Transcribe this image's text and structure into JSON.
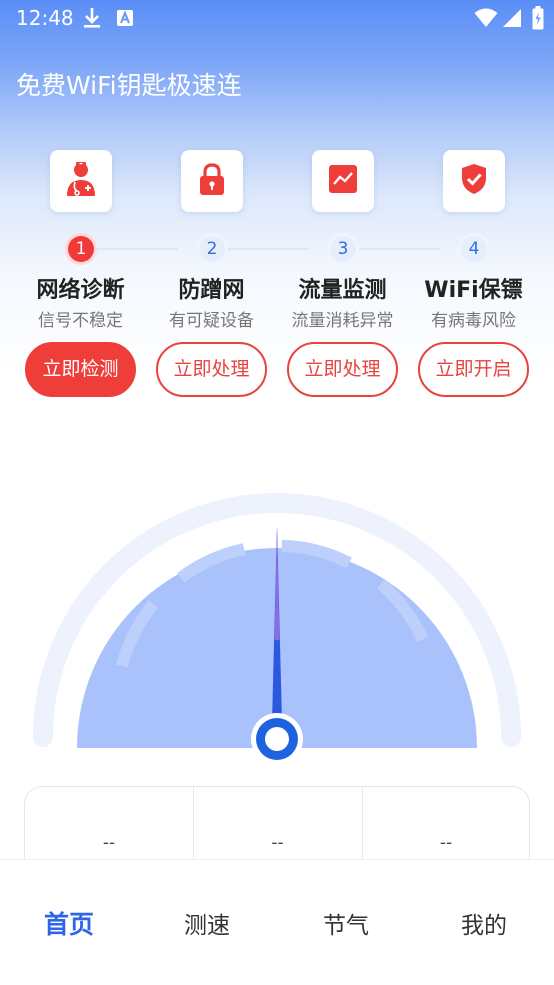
{
  "status_bar": {
    "time": "12:48",
    "left_icons": [
      "download-icon",
      "app-store-icon"
    ],
    "right_icons": [
      "wifi-icon",
      "signal-icon",
      "battery-icon"
    ]
  },
  "app_title": "免费WiFi钥匙极速连",
  "colors": {
    "primary_blue": "#2f66e8",
    "accent_red": "#ef3d3a",
    "gauge_fill": "#a9c2fb",
    "needle": "#2c58dd"
  },
  "features": [
    {
      "icon": "doctor-icon",
      "step": "1",
      "title": "网络诊断",
      "subtitle": "信号不稳定",
      "button": "立即检测",
      "button_style": "filled"
    },
    {
      "icon": "lock-icon",
      "step": "2",
      "title": "防蹭网",
      "subtitle": "有可疑设备",
      "button": "立即处理",
      "button_style": "outline"
    },
    {
      "icon": "chart-icon",
      "step": "3",
      "title": "流量监测",
      "subtitle": "流量消耗异常",
      "button": "立即处理",
      "button_style": "outline"
    },
    {
      "icon": "shield-check-icon",
      "step": "4",
      "title": "WiFi保镖",
      "subtitle": "有病毒风险",
      "button": "立即开启",
      "button_style": "outline"
    }
  ],
  "speed_panel": {
    "values": [
      "--",
      "--",
      "--"
    ]
  },
  "tabbar": {
    "tabs": [
      {
        "label": "首页",
        "active": true
      },
      {
        "label": "测速",
        "active": false
      },
      {
        "label": "节气",
        "active": false
      },
      {
        "label": "我的",
        "active": false
      }
    ]
  }
}
